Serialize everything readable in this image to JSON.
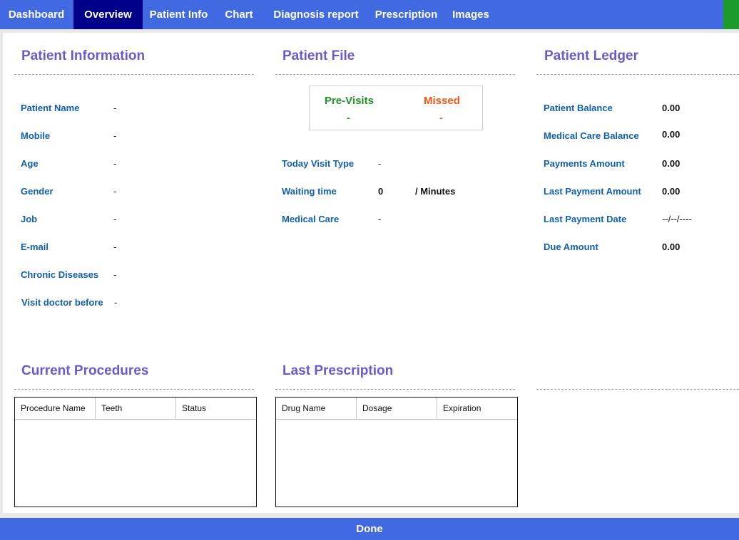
{
  "nav": {
    "tabs": [
      {
        "label": "Dashboard"
      },
      {
        "label": "Overview"
      },
      {
        "label": "Patient Info"
      },
      {
        "label": "Chart"
      },
      {
        "label": "Diagnosis report"
      },
      {
        "label": "Prescription"
      },
      {
        "label": "Images"
      }
    ],
    "active_index": 1
  },
  "patient_information": {
    "title": "Patient Information",
    "fields": [
      {
        "label": "Patient Name",
        "value": "-"
      },
      {
        "label": "Mobile",
        "value": "-"
      },
      {
        "label": "Age",
        "value": "-"
      },
      {
        "label": "Gender",
        "value": "-"
      },
      {
        "label": "Job",
        "value": "-"
      },
      {
        "label": "E-mail",
        "value": "-"
      },
      {
        "label": "Chronic Diseases",
        "value": "-"
      },
      {
        "label": "Visit doctor before",
        "value": "-"
      }
    ]
  },
  "patient_file": {
    "title": "Patient File",
    "pre_visits_label": "Pre-Visits",
    "pre_visits_value": "-",
    "missed_label": "Missed",
    "missed_value": "-",
    "today_visit_type_label": "Today Visit Type",
    "today_visit_type_value": "-",
    "waiting_time_label": "Waiting time",
    "waiting_time_value": "0",
    "waiting_time_unit": "/ Minutes",
    "medical_care_label": "Medical Care",
    "medical_care_value": "-"
  },
  "patient_ledger": {
    "title": "Patient Ledger",
    "fields": [
      {
        "label": "Patient Balance",
        "value": "0.00"
      },
      {
        "label": "Medical Care Balance",
        "value": "0.00"
      },
      {
        "label": "Payments Amount",
        "value": "0.00"
      },
      {
        "label": "Last Payment Amount",
        "value": "0.00"
      },
      {
        "label": "Last Payment Date",
        "value": "--/--/----"
      },
      {
        "label": "Due Amount",
        "value": "0.00"
      }
    ]
  },
  "current_procedures": {
    "title": "Current Procedures",
    "columns": [
      "Procedure Name",
      "Teeth",
      "Status"
    ]
  },
  "last_prescription": {
    "title": "Last Prescription",
    "columns": [
      "Drug Name",
      "Dosage",
      "Expiration"
    ]
  },
  "footer": {
    "done_label": "Done"
  },
  "colors": {
    "nav_bar": "#4169e1",
    "nav_active": "#00008b",
    "section_title": "#6a5acd",
    "field_label": "#0f5fb4",
    "pre_visits": "#22922a",
    "missed": "#f05516",
    "status_block": "#1c9a2a"
  }
}
